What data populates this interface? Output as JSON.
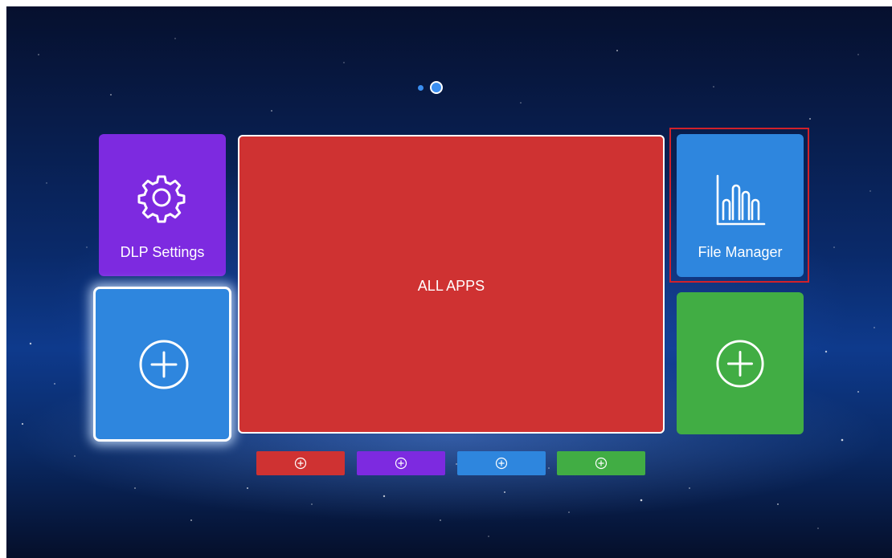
{
  "pager": {
    "page_count": 2,
    "active_page": 2
  },
  "tiles": {
    "dlp_settings": {
      "label": "DLP Settings",
      "icon": "gear-icon",
      "color": "#7d2ae0"
    },
    "add_left": {
      "icon": "add-circle-icon",
      "color": "#2e86de",
      "focused": true
    },
    "all_apps": {
      "label": "ALL APPS",
      "color": "#cf3232"
    },
    "file_manager": {
      "label": "File Manager",
      "icon": "bar-chart-icon",
      "color": "#2e86de",
      "selected": true
    },
    "add_right": {
      "icon": "add-circle-icon",
      "color": "#41ad44"
    }
  },
  "shortcut_bar": [
    {
      "icon": "add-circle-icon",
      "color": "#cf3232"
    },
    {
      "icon": "add-circle-icon",
      "color": "#7d2ae0"
    },
    {
      "icon": "add-circle-icon",
      "color": "#2e86de"
    },
    {
      "icon": "add-circle-icon",
      "color": "#41ad44"
    }
  ],
  "colors": {
    "selection_border": "#d1212a",
    "background": "#0a2a6a"
  }
}
